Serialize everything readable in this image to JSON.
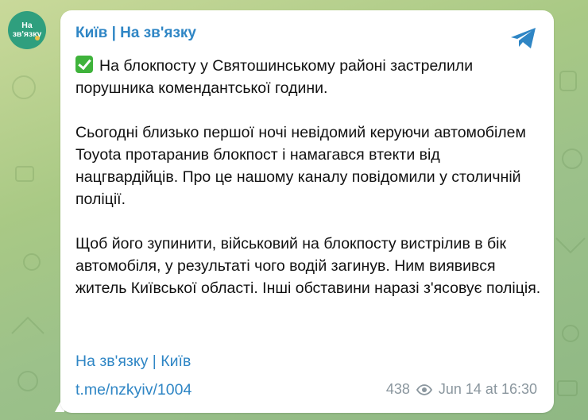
{
  "avatar": {
    "line1": "На",
    "line2": "зв'язку"
  },
  "channel": {
    "title": "Київ | На зв'язку"
  },
  "message": {
    "lead_icon": "check-mark-icon",
    "p1": "На блокпосту у Святошинському районі застрелили порушника комендантської години.",
    "p2": "Сьогодні близько першої ночі невідомий керуючи автомобілем Toyota протаранив блокпост і намагався втекти від нацгвардійців. Про це нашому каналу повідомили у столичній поліції.",
    "p3": "Щоб його зупинити, військовий на блокпосту вистрілив в бік автомобіля, у результаті чого водій загинув. Ним виявився житель Київської області. Інші обставини наразі з'ясовує поліція.",
    "footer_link": "На зв'язку | Київ",
    "url": "t.me/nzkyiv/1004"
  },
  "meta": {
    "views": "438",
    "timestamp": "Jun 14 at 16:30"
  },
  "colors": {
    "accent": "#2f86c5",
    "avatar_bg": "#2f9f7e",
    "check_bg": "#3fb33b"
  }
}
